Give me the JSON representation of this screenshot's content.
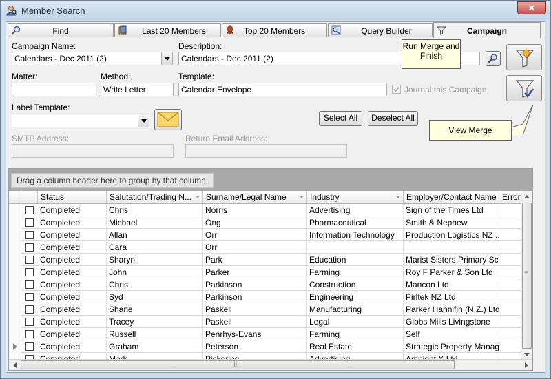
{
  "window": {
    "title": "Member Search",
    "title_icon": "user-search-icon",
    "close_glyph": "✕"
  },
  "tabs": [
    {
      "label": "Find",
      "icon": "magnifier-icon",
      "active": false
    },
    {
      "label": "Last 20 Members",
      "icon": "book-icon",
      "active": false
    },
    {
      "label": "Top 20 Members",
      "icon": "ribbon-icon",
      "active": false
    },
    {
      "label": "Query Builder",
      "icon": "query-icon",
      "active": false
    },
    {
      "label": "Campaign",
      "icon": "funnel-icon",
      "active": true
    }
  ],
  "form": {
    "campaign_name_label": "Campaign Name:",
    "campaign_name_value": "Calendars - Dec 2011 (2)",
    "description_label": "Description:",
    "description_value": "Calendars - Dec 2011 (2)",
    "matter_label": "Matter:",
    "matter_value": "",
    "method_label": "Method:",
    "method_value": "Write Letter",
    "template_label": "Template:",
    "template_value": "Calendar Envelope",
    "journal_label": "Journal this Campaign",
    "journal_checked": true,
    "label_template_label": "Label Template:",
    "label_template_value": "",
    "smtp_label": "SMTP Address:",
    "smtp_value": "",
    "return_email_label": "Return Email Address:",
    "return_email_value": ""
  },
  "buttons": {
    "select_all": "Select All",
    "deselect_all": "Deselect All"
  },
  "callouts": {
    "run_merge": "Run Merge and Finish",
    "view_merge": "View Merge"
  },
  "grid": {
    "group_hint": "Drag a column header here to group by that column.",
    "columns": [
      "Status",
      "Salutation/Trading N...",
      "Surname/Legal Name",
      "Industry",
      "Employer/Contact Name",
      "Error"
    ],
    "rows": [
      {
        "status": "Completed",
        "salutation": "Chris",
        "surname": "Norris",
        "industry": "Advertising",
        "employer": "Sign of the Times Ltd",
        "error": "",
        "current": false
      },
      {
        "status": "Completed",
        "salutation": "Michael",
        "surname": "Ong",
        "industry": "Pharmaceutical",
        "employer": "Smith & Nephew",
        "error": "",
        "current": false
      },
      {
        "status": "Completed",
        "salutation": "Allan",
        "surname": "Orr",
        "industry": "Information Technology",
        "employer": "Production Logistics NZ ...",
        "error": "",
        "current": false
      },
      {
        "status": "Completed",
        "salutation": "Cara",
        "surname": "Orr",
        "industry": "",
        "employer": "",
        "error": "",
        "current": false
      },
      {
        "status": "Completed",
        "salutation": "Sharyn",
        "surname": "Park",
        "industry": "Education",
        "employer": "Marist Sisters Primary Sch...",
        "error": "",
        "current": false
      },
      {
        "status": "Completed",
        "salutation": "John",
        "surname": "Parker",
        "industry": "Farming",
        "employer": "Roy F Parker & Son Ltd",
        "error": "",
        "current": false
      },
      {
        "status": "Completed",
        "salutation": "Chris",
        "surname": "Parkinson",
        "industry": "Construction",
        "employer": "Mancon Ltd",
        "error": "",
        "current": false
      },
      {
        "status": "Completed",
        "salutation": "Syd",
        "surname": "Parkinson",
        "industry": "Engineering",
        "employer": "Pirltek NZ Ltd",
        "error": "",
        "current": false
      },
      {
        "status": "Completed",
        "salutation": "Shane",
        "surname": "Paskell",
        "industry": "Manufacturing",
        "employer": "Parker Hannifin (N.Z.) Ltd",
        "error": "",
        "current": false
      },
      {
        "status": "Completed",
        "salutation": "Tracey",
        "surname": "Paskell",
        "industry": "Legal",
        "employer": "Gibbs Mills Livingstone",
        "error": "",
        "current": false
      },
      {
        "status": "Completed",
        "salutation": "Russell",
        "surname": "Penrhys-Evans",
        "industry": "Farming",
        "employer": "Self",
        "error": "",
        "current": false
      },
      {
        "status": "Completed",
        "salutation": "Graham",
        "surname": "Peterson",
        "industry": "Real Estate",
        "employer": "Strategic Property Manag...",
        "error": "",
        "current": true
      },
      {
        "status": "Completed",
        "salutation": "Mark",
        "surname": "Pickering",
        "industry": "Advertising",
        "employer": "Ambient X Ltd",
        "error": "",
        "current": false
      }
    ],
    "hscroll_grip": "|||",
    "vscroll_grip": "≡"
  },
  "colors": {
    "window_frame": "#cfdceb",
    "panel": "#f0f0f0",
    "group_panel": "#a9a9a9",
    "callout_bg": "#ffffe1"
  }
}
